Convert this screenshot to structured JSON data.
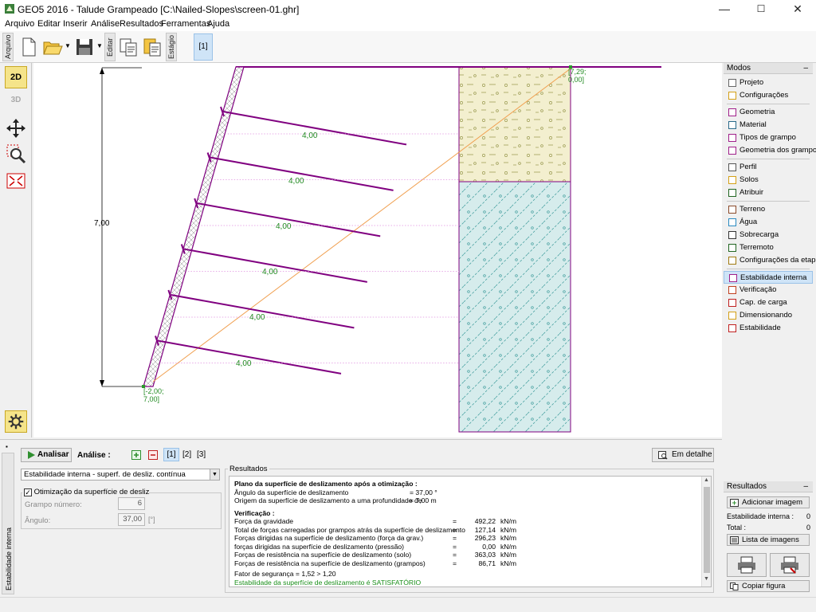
{
  "window": {
    "title": "GEO5 2016 - Talude Grampeado [C:\\Nailed-Slopes\\screen-01.ghr]",
    "minimize": "—",
    "maximize": "☐",
    "close": "✕"
  },
  "menu": [
    "Arquivo",
    "Editar",
    "Inserir",
    "Análise",
    "Resultados",
    "Ferramentas",
    "Ajuda"
  ],
  "toolbar": {
    "tab_file": "Arquivo",
    "tab_edit": "Editar",
    "tab_stage": "Estágio",
    "stage_active": "[1]"
  },
  "leftbar": {
    "view_2d": "2D",
    "view_3d": "3D"
  },
  "drawing": {
    "height_label": "7,00",
    "top_right_coord_1": "[7,29;",
    "top_right_coord_2": "0,00]",
    "bottom_left_coord_1": "[-2,00;",
    "bottom_left_coord_2": "7,00]",
    "nails": [
      {
        "length_label": "4,00"
      },
      {
        "length_label": "4,00"
      },
      {
        "length_label": "4,00"
      },
      {
        "length_label": "4,00"
      },
      {
        "length_label": "4,00"
      },
      {
        "length_label": "4,00"
      }
    ],
    "colors": {
      "wall": "#800080",
      "nail": "#800080",
      "slip_surface": "#f0a050",
      "soil_upper": "#f3efcf",
      "soil_lower": "#d6ecec",
      "label_green": "#228b22"
    }
  },
  "modes": {
    "title": "Modos",
    "collapse": "–",
    "groups": [
      [
        {
          "label": "Projeto",
          "icon": "document-icon"
        },
        {
          "label": "Configurações",
          "icon": "gear-icon"
        }
      ],
      [
        {
          "label": "Geometria",
          "icon": "geometry-icon"
        },
        {
          "label": "Material",
          "icon": "material-icon"
        },
        {
          "label": "Tipos de grampo",
          "icon": "nail-type-icon"
        },
        {
          "label": "Geometria dos grampos",
          "icon": "nail-geometry-icon"
        }
      ],
      [
        {
          "label": "Perfil",
          "icon": "profile-icon"
        },
        {
          "label": "Solos",
          "icon": "soils-icon"
        },
        {
          "label": "Atribuir",
          "icon": "assign-icon"
        }
      ],
      [
        {
          "label": "Terreno",
          "icon": "terrain-icon"
        },
        {
          "label": "Água",
          "icon": "water-icon"
        },
        {
          "label": "Sobrecarga",
          "icon": "surcharge-icon"
        },
        {
          "label": "Terremoto",
          "icon": "earthquake-icon"
        },
        {
          "label": "Configurações da etapa",
          "icon": "stage-settings-icon"
        }
      ],
      [
        {
          "label": "Estabilidade interna",
          "icon": "internal-stability-icon",
          "active": true
        },
        {
          "label": "Verificação",
          "icon": "verification-icon"
        },
        {
          "label": "Cap. de carga",
          "icon": "bearing-capacity-icon"
        },
        {
          "label": "Dimensionando",
          "icon": "dimensioning-icon"
        },
        {
          "label": "Estabilidade",
          "icon": "stability-icon"
        }
      ]
    ]
  },
  "results_panel": {
    "title": "Resultados",
    "collapse": "–",
    "add_image": "Adicionar imagem",
    "internal_stability_label": "Estabilidade interna :",
    "internal_stability_count": "0",
    "total_label": "Total :",
    "total_count": "0",
    "image_list": "Lista de imagens",
    "copy_figure": "Copiar figura"
  },
  "analysis": {
    "side_tab": "Estabilidade interna",
    "analyze_button": "Analisar",
    "analysis_label": "Análise :",
    "analysis_tabs": [
      "[1]",
      "[2]",
      "[3]"
    ],
    "detail_button": "Em detalhe",
    "method_select": "Estabilidade interna - superf. de desliz. contínua",
    "optimization_checkbox": "Otimização da superfície de deslizamento",
    "optimization_checked": true,
    "nail_number_label": "Grampo número:",
    "nail_number_value": "6",
    "angle_label": "Ângulo:",
    "angle_value": "37,00",
    "angle_unit": "[°]"
  },
  "results": {
    "group_title": "Resultados",
    "heading": "Plano da superfície de deslizamento após a otimização :",
    "lines_top": [
      {
        "label": "Ângulo da superfície de deslizamento",
        "value": "= 37,00 °"
      },
      {
        "label": "Origem da superfície de deslizamento a uma profundidade de",
        "value": "=   7,00  m"
      }
    ],
    "verification_heading": "Verificação :",
    "lines": [
      {
        "label": "Força da gravidade",
        "eq": "=",
        "num": "492,22",
        "unit": "kN/m"
      },
      {
        "label": "Total de forças carregadas por grampos atrás da superfície de deslizamento",
        "eq": "=",
        "num": "127,14",
        "unit": "kN/m"
      },
      {
        "label": "Forças dirigidas na superfície de deslizamento (força da grav.)",
        "eq": "=",
        "num": "296,23",
        "unit": "kN/m"
      },
      {
        "label": "forças dirigidas na superfície de deslizamento (pressão)",
        "eq": "=",
        "num": "0,00",
        "unit": "kN/m"
      },
      {
        "label": "Forças de resistência na superfície de deslizamento (solo)",
        "eq": "=",
        "num": "363,03",
        "unit": "kN/m"
      },
      {
        "label": "Forças de resistência na superfície de deslizamento (grampos)",
        "eq": "=",
        "num": "86,71",
        "unit": "kN/m"
      }
    ],
    "safety_factor": "Fator de segurança = 1,52 > 1,20",
    "conclusion": "Estabilidade da superfície de deslizamento é SATISFATÓRIO",
    "conclusion_color": "#1a8f1a"
  }
}
